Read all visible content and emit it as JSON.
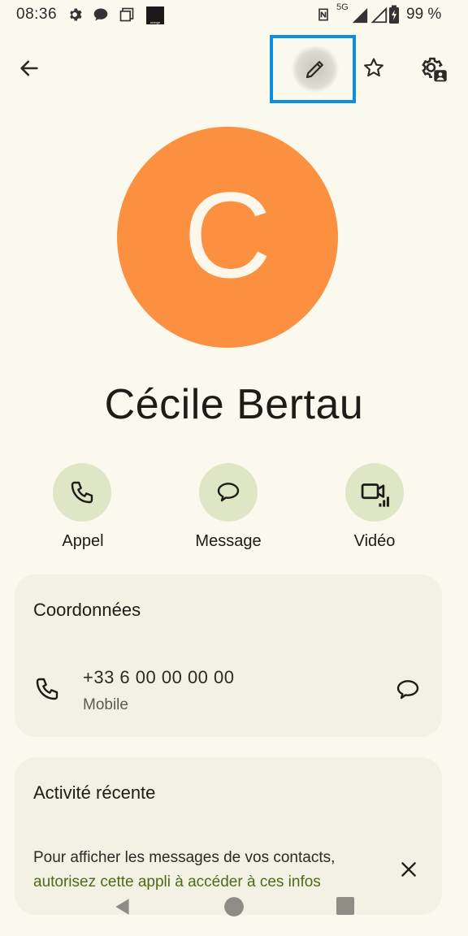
{
  "status_bar": {
    "time": "08:36",
    "carrier_tile": "orange",
    "network": "5G",
    "battery": "99 %"
  },
  "toolbar": {
    "back_icon": "arrow-left-icon",
    "edit_icon": "pencil-icon",
    "favorite_icon": "star-outline-icon",
    "settings_icon": "contact-settings-icon"
  },
  "contact": {
    "initial": "C",
    "name": "Cécile Bertau",
    "avatar_color": "#fb9040"
  },
  "actions": [
    {
      "label": "Appel",
      "icon": "phone-icon"
    },
    {
      "label": "Message",
      "icon": "message-icon"
    },
    {
      "label": "Vidéo",
      "icon": "video-icon"
    }
  ],
  "details_card": {
    "title": "Coordonnées",
    "phone_number": "+33 6 00 00 00 00",
    "phone_type": "Mobile"
  },
  "activity_card": {
    "title": "Activité récente",
    "text": "Pour afficher les messages de vos contacts,",
    "link": "autorisez cette appli à accéder à ces infos"
  },
  "colors": {
    "background": "#fbf9ee",
    "card": "#f2f1e4",
    "action_circle": "#dfe6c6",
    "link": "#4d6a18",
    "highlight": "#0a8fe0"
  }
}
